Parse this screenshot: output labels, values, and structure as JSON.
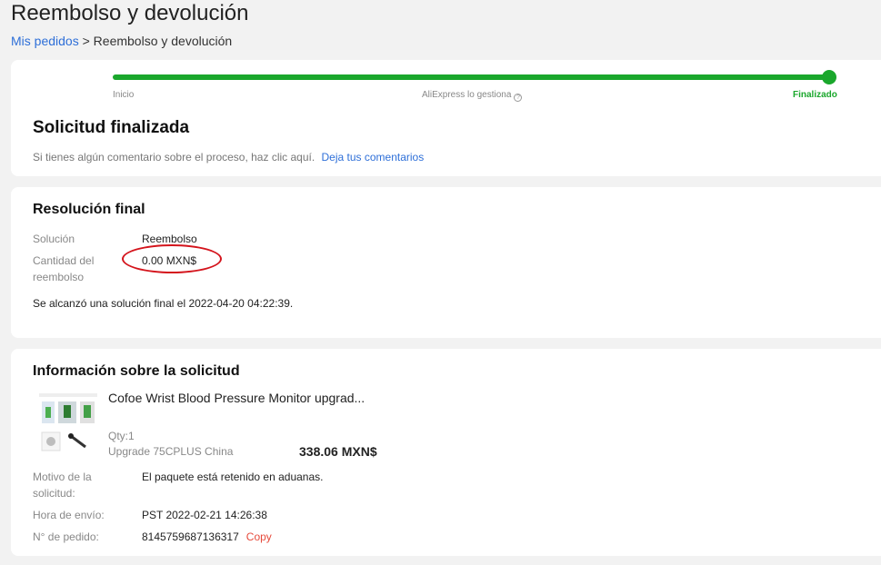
{
  "header": {
    "title": "Reembolso y devolución",
    "breadcrumb": {
      "link": "Mis pedidos",
      "separator": ">",
      "current": "Reembolso y devolución"
    }
  },
  "progress": {
    "completed_fraction": 1.0,
    "steps": [
      "Inicio",
      "AliExpress lo gestiona",
      "Finalizado"
    ],
    "accent_color": "#1aa72c"
  },
  "status": {
    "title": "Solicitud finalizada",
    "comment_text": "Si tienes algún comentario sobre el proceso, haz clic aquí.",
    "comment_link": "Deja tus comentarios"
  },
  "resolution": {
    "title": "Resolución final",
    "solution_label": "Solución",
    "solution_value": "Reembolso",
    "amount_label": "Cantidad del reembolso",
    "amount_value": "0.00 MXN$",
    "final_note": "Se alcanzó una solución final el 2022-04-20 04:22:39."
  },
  "info": {
    "title": "Información sobre la solicitud",
    "product": {
      "name": "Cofoe Wrist Blood Pressure Monitor upgrad...",
      "qty": "Qty:1",
      "variant": "Upgrade 75CPLUS China",
      "price": "338.06 MXN$"
    },
    "reason_label": "Motivo de la solicitud:",
    "reason_value": "El paquete está retenido en aduanas.",
    "ship_label": "Hora de envío:",
    "ship_value": "PST 2022-02-21 14:26:38",
    "order_label": "N° de pedido:",
    "order_value": "8145759687136317",
    "copy_label": "Copy"
  }
}
